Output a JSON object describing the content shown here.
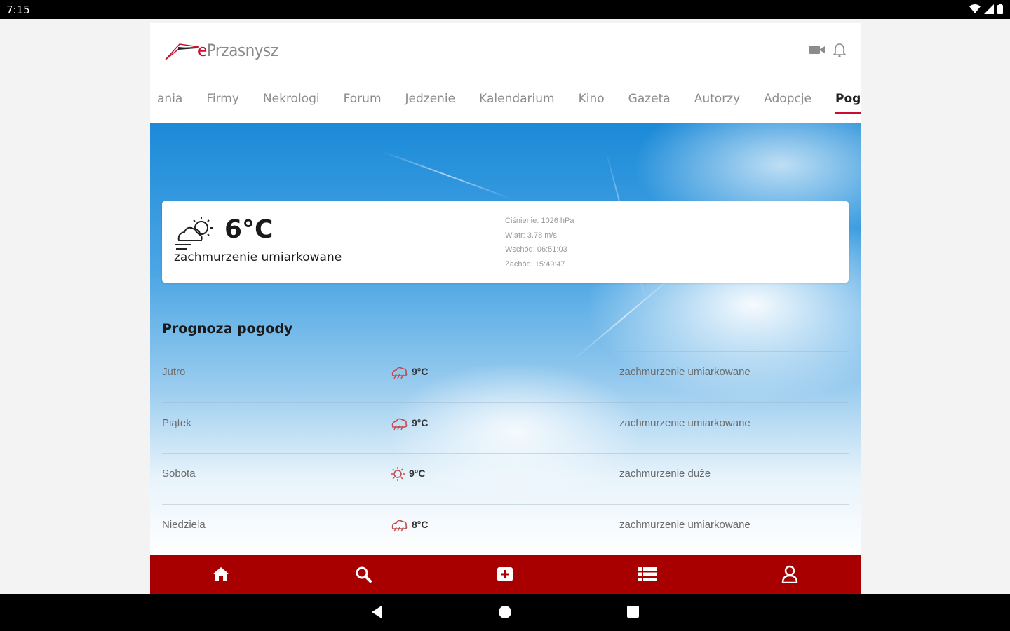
{
  "status_bar": {
    "time": "7:15"
  },
  "app": {
    "logo": {
      "e": "e",
      "name": "Przasnysz"
    },
    "nav_tabs": [
      "ania",
      "Firmy",
      "Nekrologi",
      "Forum",
      "Jedzenie",
      "Kalendarium",
      "Kino",
      "Gazeta",
      "Autorzy",
      "Adopcje",
      "Pogoda"
    ],
    "active_tab": "Pogoda"
  },
  "current": {
    "temp": "6°C",
    "description": "zachmurzenie umiarkowane",
    "pressure": "Ciśnienie: 1026 hPa",
    "wind": "Wiatr: 3.78 m/s",
    "sunrise": "Wschód: 06:51:03",
    "sunset": "Zachód: 15:49:47"
  },
  "forecast": {
    "title": "Prognoza pogody",
    "days": [
      {
        "day": "Jutro",
        "icon": "rain-cloud-icon",
        "temp": "9°C",
        "desc": "zachmurzenie umiarkowane"
      },
      {
        "day": "Piątek",
        "icon": "rain-cloud-icon",
        "temp": "9°C",
        "desc": "zachmurzenie umiarkowane"
      },
      {
        "day": "Sobota",
        "icon": "sun-cloud-icon",
        "temp": "9°C",
        "desc": "zachmurzenie duże"
      },
      {
        "day": "Niedziela",
        "icon": "rain-cloud-icon",
        "temp": "8°C",
        "desc": "zachmurzenie umiarkowane"
      }
    ]
  },
  "bottom_nav": [
    "home-icon",
    "search-icon",
    "add-icon",
    "list-icon",
    "user-icon"
  ],
  "colors": {
    "brand_red": "#a80000",
    "accent_red": "#c8102e"
  }
}
